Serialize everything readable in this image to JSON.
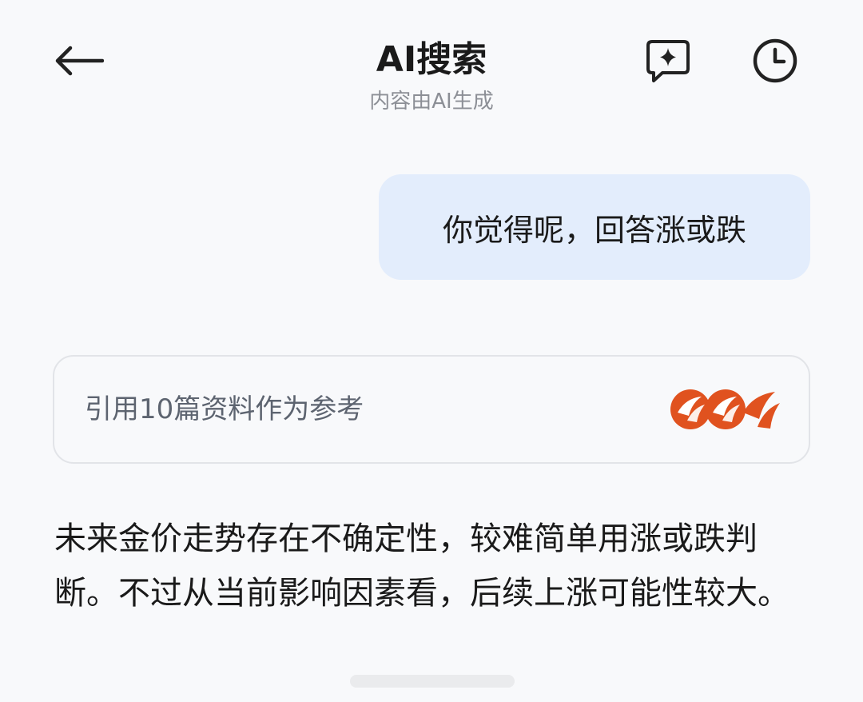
{
  "header": {
    "title": "AI搜索",
    "subtitle": "内容由AI生成",
    "back_icon": "arrow-left-icon",
    "new_chat_icon": "chat-sparkle-icon",
    "history_icon": "clock-icon"
  },
  "conversation": {
    "user_message": "你觉得呢，回答涨或跌",
    "references_label": "引用10篇资料作为参考",
    "source_icons": [
      "source-logo-icon",
      "source-logo-icon",
      "source-logo-icon"
    ],
    "answer_text": "未来金价走势存在不确定性，较难简单用涨或跌判断。不过从当前影响因素看，后续上涨可能性较大。"
  },
  "colors": {
    "background": "#f8f9fb",
    "user_bubble": "#e3edfc",
    "source_logo": "#e0521f"
  }
}
